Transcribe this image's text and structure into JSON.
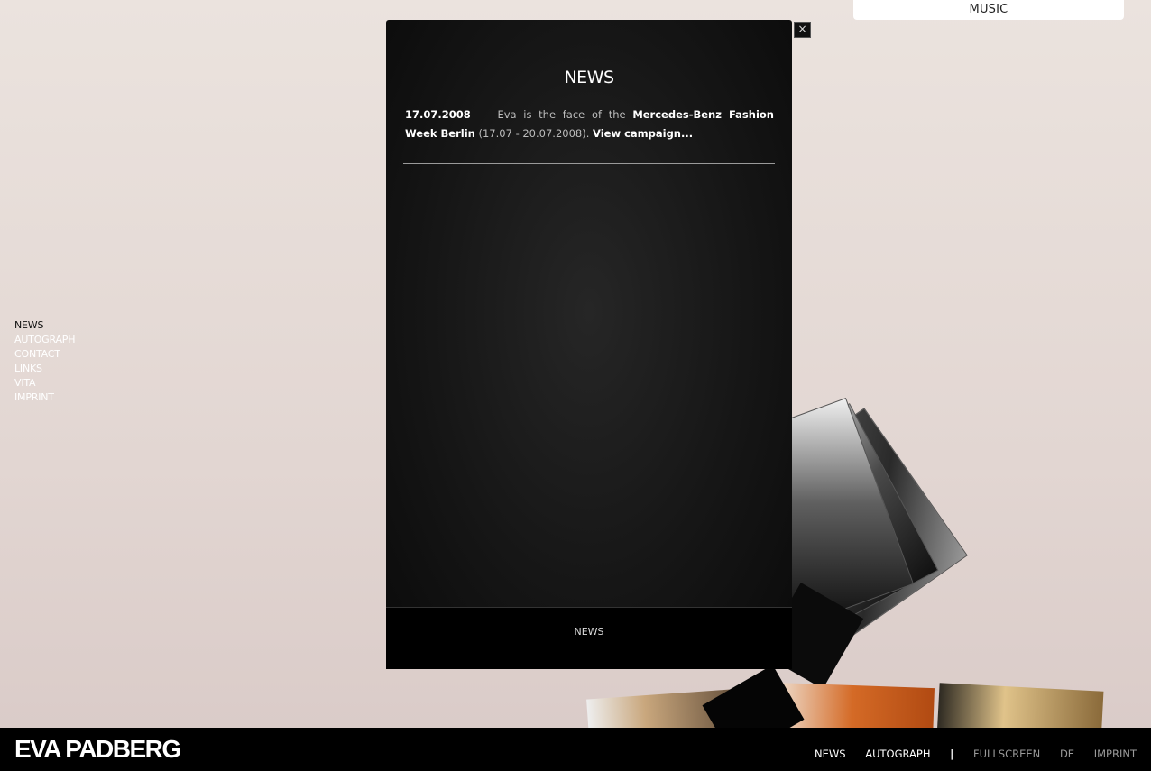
{
  "music_bar": {
    "label": "MUSIC"
  },
  "left_nav": {
    "items": [
      "NEWS",
      "AUTOGRAPH",
      "CONTACT",
      "LINKS",
      "VITA",
      "IMPRINT"
    ]
  },
  "modal": {
    "title": "NEWS",
    "close_label": "×",
    "news": [
      {
        "date": "17.07.2008",
        "text_before": "Eva is the face of the",
        "highlight": "Mercedes-Benz Fashion Week Berlin",
        "text_after": "(17.07 - 20.07.2008).",
        "link": "View campaign..."
      }
    ],
    "footer_tab": "NEWS"
  },
  "bottom_bar": {
    "logo": "EVA PADBERG",
    "nav_primary": [
      "NEWS",
      "AUTOGRAPH"
    ],
    "separator": "|",
    "nav_secondary": [
      "FULLSCREEN",
      "DE",
      "IMPRINT"
    ]
  }
}
